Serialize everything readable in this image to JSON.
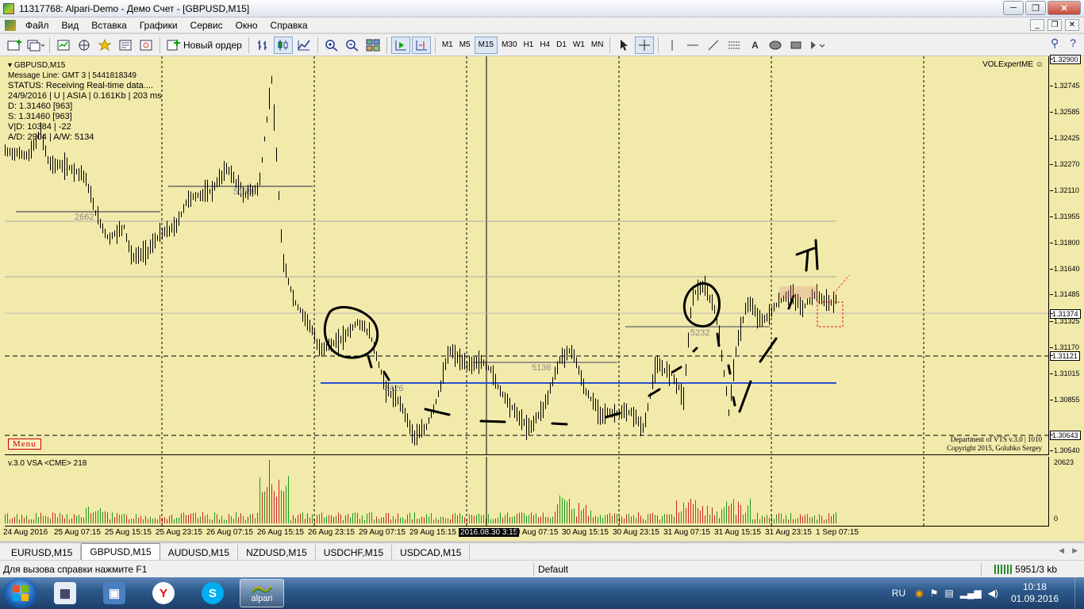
{
  "window": {
    "title": "11317768: Alpari-Demo - Демо Счет - [GBPUSD,M15]",
    "minimize": "─",
    "maximize": "❐",
    "close": "✕"
  },
  "menu": {
    "items": [
      "Файл",
      "Вид",
      "Вставка",
      "Графики",
      "Сервис",
      "Окно",
      "Справка"
    ],
    "mdi_min": "_",
    "mdi_restore": "❐",
    "mdi_close": "✕"
  },
  "toolbar": {
    "new_order_label": "Новый ордер",
    "periods": [
      "M1",
      "M5",
      "M15",
      "M30",
      "H1",
      "H4",
      "D1",
      "W1",
      "MN"
    ],
    "active_period": "M15",
    "text_tool": "A"
  },
  "chart": {
    "symbol_line": "GBPUSD,M15",
    "info_lines": [
      "Message Line: GMT 3 | 5441818349",
      "STATUS:  Receiving Real-time data....",
      "24/9/2016 | U | ASIA | 0.161Kb | 203 ms",
      "D: 1.31460  [963]",
      "S: 1.31460  [963]",
      "V|D: 10384 | -22",
      "A/D: 2904 | A/W: 5134"
    ],
    "expert_label": "VOLExpertME ☺",
    "menu_badge": "Menu",
    "copyright_line1": "Department of VTS  v.3.0 | 1010",
    "copyright_line2": "Copyright 2015, Golubko Sergey",
    "vsa_label": "v.3.0 VSA <CME> 218",
    "level_labels": [
      "2662",
      "5139",
      "5136",
      "5232",
      "3426"
    ],
    "price_axis": [
      {
        "label": "1.32900",
        "tag": true
      },
      {
        "label": "1.32745"
      },
      {
        "label": "1.32585"
      },
      {
        "label": "1.32425"
      },
      {
        "label": "1.32270"
      },
      {
        "label": "1.32110"
      },
      {
        "label": "1.31955"
      },
      {
        "label": "1.31800"
      },
      {
        "label": "1.31640"
      },
      {
        "label": "1.31485"
      },
      {
        "label": "1.31374",
        "tag": true
      },
      {
        "label": "1.31325"
      },
      {
        "label": "1.31170"
      },
      {
        "label": "1.31121",
        "tag": true
      },
      {
        "label": "1.31015"
      },
      {
        "label": "1.30855"
      },
      {
        "label": "1.30643",
        "tag": true
      },
      {
        "label": "1.30540"
      }
    ],
    "volume_axis": [
      "20623",
      "0"
    ],
    "time_axis": [
      "24 Aug 2016",
      "25 Aug 07:15",
      "25 Aug 15:15",
      "25 Aug 23:15",
      "26 Aug 07:15",
      "26 Aug 15:15",
      "26 Aug 23:15",
      "29 Aug 07:15",
      "29 Aug 15:15",
      "2016.08.30 3:15",
      "0 Aug 07:15",
      "30 Aug 15:15",
      "30 Aug 23:15",
      "31 Aug 07:15",
      "31 Aug 15:15",
      "31 Aug 23:15",
      "1 Sep 07:15"
    ],
    "highlight_time": "2016.08.30 3:15",
    "colors": {
      "background": "#f2eaaa",
      "candle": "#000000",
      "blue_level": "#2a4fcf",
      "vol_green": "#1a9a1a",
      "vol_red": "#cc2222"
    }
  },
  "tabs": {
    "items": [
      "EURUSD,M15",
      "GBPUSD,M15",
      "AUDUSD,M15",
      "NZDUSD,M15",
      "USDCHF,M15",
      "USDCAD,M15"
    ],
    "active": "GBPUSD,M15"
  },
  "status": {
    "help": "Для вызова справки нажмите F1",
    "profile": "Default",
    "connection": "5951/3 kb"
  },
  "taskbar": {
    "apps": [
      "calculator",
      "remote-desktop",
      "yandex",
      "skype",
      "alpari"
    ],
    "active_app_label": "alpari",
    "lang": "RU",
    "time": "10:18",
    "date": "01.09.2016"
  }
}
